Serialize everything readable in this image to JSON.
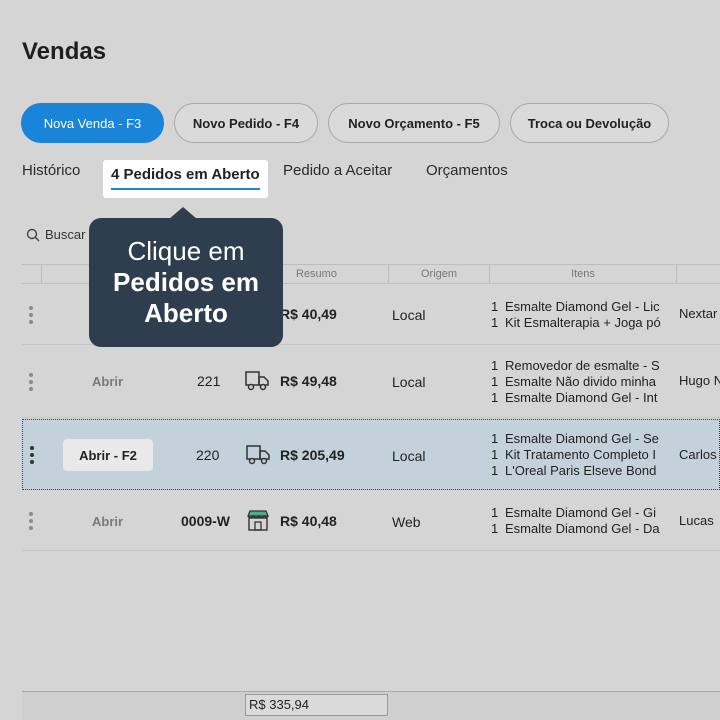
{
  "page": {
    "title": "Vendas"
  },
  "actions": [
    {
      "label": "Nova Venda - F3"
    },
    {
      "label": "Novo Pedido - F4"
    },
    {
      "label": "Novo Orçamento - F5"
    },
    {
      "label": "Troca ou Devolução"
    }
  ],
  "tabs": [
    {
      "label": "Histórico"
    },
    {
      "label": "4 Pedidos em Aberto"
    },
    {
      "label": "Pedido a Aceitar"
    },
    {
      "label": "Orçamentos"
    }
  ],
  "tooltip": {
    "line1": "Clique em",
    "line2": "Pedidos em",
    "line3": "Aberto"
  },
  "search": {
    "label": "Buscar"
  },
  "columns": {
    "resumo": "Resumo",
    "origem": "Origem",
    "itens": "Itens"
  },
  "rows": [
    {
      "action": "",
      "number": "",
      "value": "R$ 40,49",
      "origin": "Local",
      "items": [
        {
          "qty": "1",
          "name": "Esmalte Diamond Gel - Lic"
        },
        {
          "qty": "1",
          "name": "Kit Esmalterapia + Joga pó"
        }
      ],
      "client": "Nextar"
    },
    {
      "action": "Abrir",
      "number": "221",
      "value": "R$ 49,48",
      "origin": "Local",
      "items": [
        {
          "qty": "1",
          "name": "Removedor de esmalte - S"
        },
        {
          "qty": "1",
          "name": "Esmalte Não divido minha"
        },
        {
          "qty": "1",
          "name": "Esmalte Diamond Gel - Int"
        }
      ],
      "client": "Hugo N"
    },
    {
      "action": "Abrir - F2",
      "number": "220",
      "value": "R$ 205,49",
      "origin": "Local",
      "items": [
        {
          "qty": "1",
          "name": "Esmalte Diamond Gel - Se"
        },
        {
          "qty": "1",
          "name": "Kit Tratamento Completo I"
        },
        {
          "qty": "1",
          "name": "L'Oreal Paris Elseve Bond"
        }
      ],
      "client": "Carlos"
    },
    {
      "action": "Abrir",
      "number": "0009-W",
      "value": "R$ 40,48",
      "origin": "Web",
      "items": [
        {
          "qty": "1",
          "name": "Esmalte Diamond Gel - Gi"
        },
        {
          "qty": "1",
          "name": "Esmalte Diamond Gel - Da"
        }
      ],
      "client": "Lucas"
    }
  ],
  "footer": {
    "total": "R$ 335,94"
  },
  "colors": {
    "accent": "#1a84d8",
    "tooltip_bg": "#2e3e4e",
    "selected_row": "#c3d1db"
  },
  "icons": {
    "delivery": "delivery-truck-icon",
    "store": "storefront-icon",
    "more": "more-vertical-icon",
    "search": "search-icon"
  }
}
